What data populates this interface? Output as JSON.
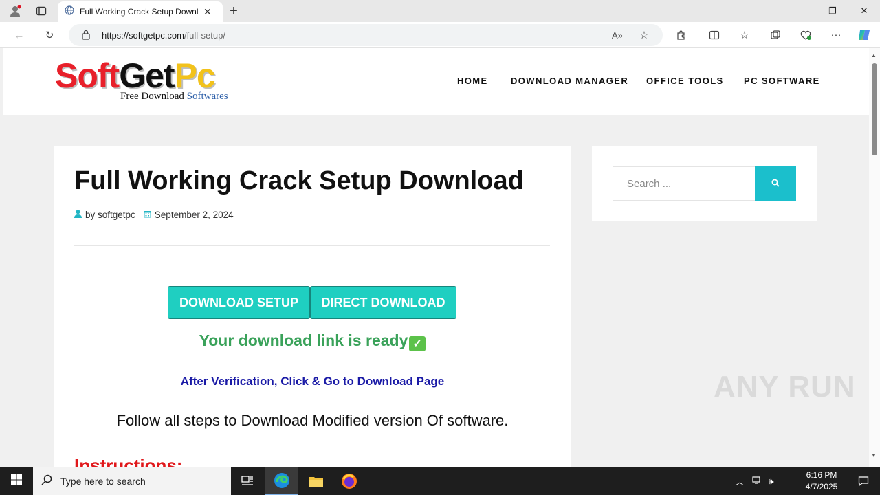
{
  "browser": {
    "tab_title": "Full Working Crack Setup Download",
    "url_domain": "https://softgetpc.com",
    "url_path": "/full-setup/",
    "icons": [
      "profile-icon",
      "tab-actions-icon",
      "globe-icon",
      "close-icon",
      "new-tab-icon",
      "back-icon",
      "refresh-icon",
      "lock-icon",
      "read-aloud-icon",
      "favorite-icon",
      "extensions-icon",
      "split-screen-icon",
      "favorites-icon",
      "collections-icon",
      "performance-icon",
      "more-icon",
      "copilot-icon"
    ]
  },
  "site": {
    "logo_soft": "Soft",
    "logo_get": "Get",
    "logo_pc": "Pc",
    "tagline_1": "Free Download",
    "tagline_2": "Softwares",
    "nav": [
      "HOME",
      "DOWNLOAD MANAGER",
      "OFFICE TOOLS",
      "PC SOFTWARE"
    ]
  },
  "article": {
    "title": "Full Working Crack Setup Download",
    "author": "by softgetpc",
    "date": "September 2, 2024",
    "btn_setup": "DOWNLOAD SETUP",
    "btn_direct": "DIRECT DOWNLOAD",
    "ready_text": "Your download link is ready",
    "verify_text": "After Verification, Click & Go to Download Page",
    "follow_text": "Follow all steps to Download Modified version Of software.",
    "instructions": "Instructions:"
  },
  "sidebar": {
    "search_placeholder": "Search ..."
  },
  "watermark": "ANY RUN",
  "taskbar": {
    "search_placeholder": "Type here to search",
    "time": "6:16 PM",
    "date": "4/7/2025"
  },
  "colors": {
    "accent_teal": "#1fcfc1",
    "ready_green": "#3aa25a",
    "link_blue": "#1a1aa6",
    "instructions_red": "#e0181b"
  }
}
